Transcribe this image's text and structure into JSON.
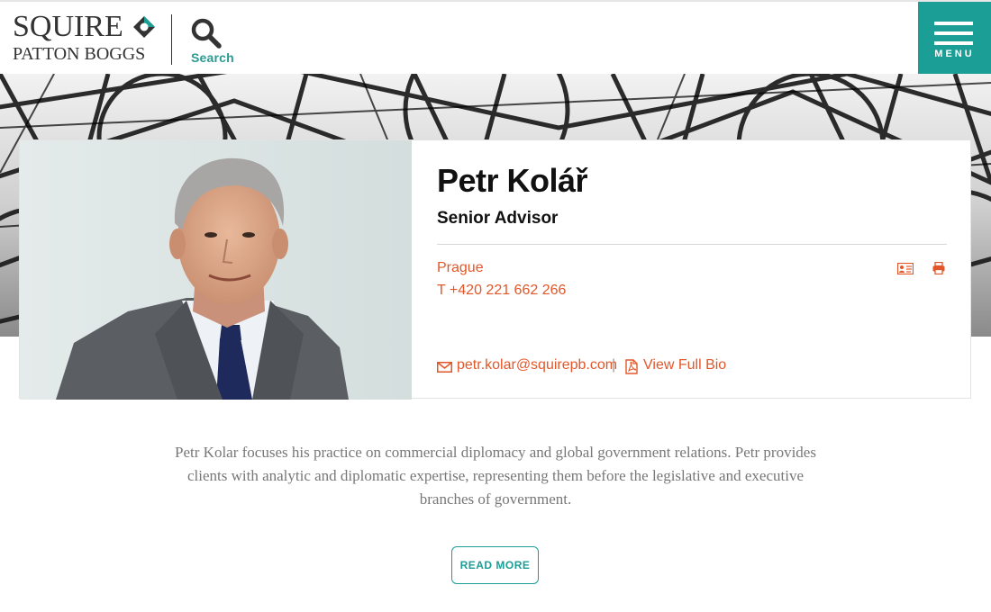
{
  "header": {
    "logo_line1": "SQUIRE",
    "logo_line2": "PATTON BOGGS",
    "search_label": "Search",
    "menu_label": "MENU"
  },
  "profile": {
    "name": "Petr Kolář",
    "title": "Senior Advisor",
    "office": "Prague",
    "phone": "T +420 221 662 266",
    "email": "petr.kolar@squirepb.com",
    "links_separator": "|",
    "bio_link": "View Full Bio"
  },
  "summary": {
    "text": "Petr Kolar focuses his practice on commercial diplomacy and global government relations. Petr provides clients with analytic and diplomatic expertise, representing them before the legislative and executive branches of government.",
    "read_more": "READ MORE"
  },
  "icons": {
    "search": "search-icon",
    "menu": "hamburger-icon",
    "vcard": "vcard-icon",
    "print": "print-icon",
    "email": "envelope-icon",
    "pdf": "pdf-icon"
  },
  "colors": {
    "accent_teal": "#1b9e95",
    "accent_orange": "#e2572a",
    "text_dark": "#111111",
    "text_muted": "#777777"
  }
}
